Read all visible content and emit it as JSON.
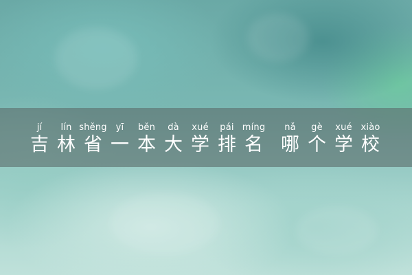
{
  "title": {
    "chars": [
      {
        "py": "jí",
        "hz": "吉"
      },
      {
        "py": "lín",
        "hz": "林"
      },
      {
        "py": "shěng",
        "hz": "省"
      },
      {
        "py": "yī",
        "hz": "一"
      },
      {
        "py": "běn",
        "hz": "本"
      },
      {
        "py": "dà",
        "hz": "大"
      },
      {
        "py": "xué",
        "hz": "学"
      },
      {
        "py": "pái",
        "hz": "排"
      },
      {
        "py": "míng",
        "hz": "名"
      },
      {
        "py": "nǎ",
        "hz": "哪"
      },
      {
        "py": "gè",
        "hz": "个"
      },
      {
        "py": "xué",
        "hz": "学"
      },
      {
        "py": "xiào",
        "hz": "校"
      }
    ]
  },
  "colors": {
    "band": "#5c6e6c",
    "text": "#ffffff"
  }
}
